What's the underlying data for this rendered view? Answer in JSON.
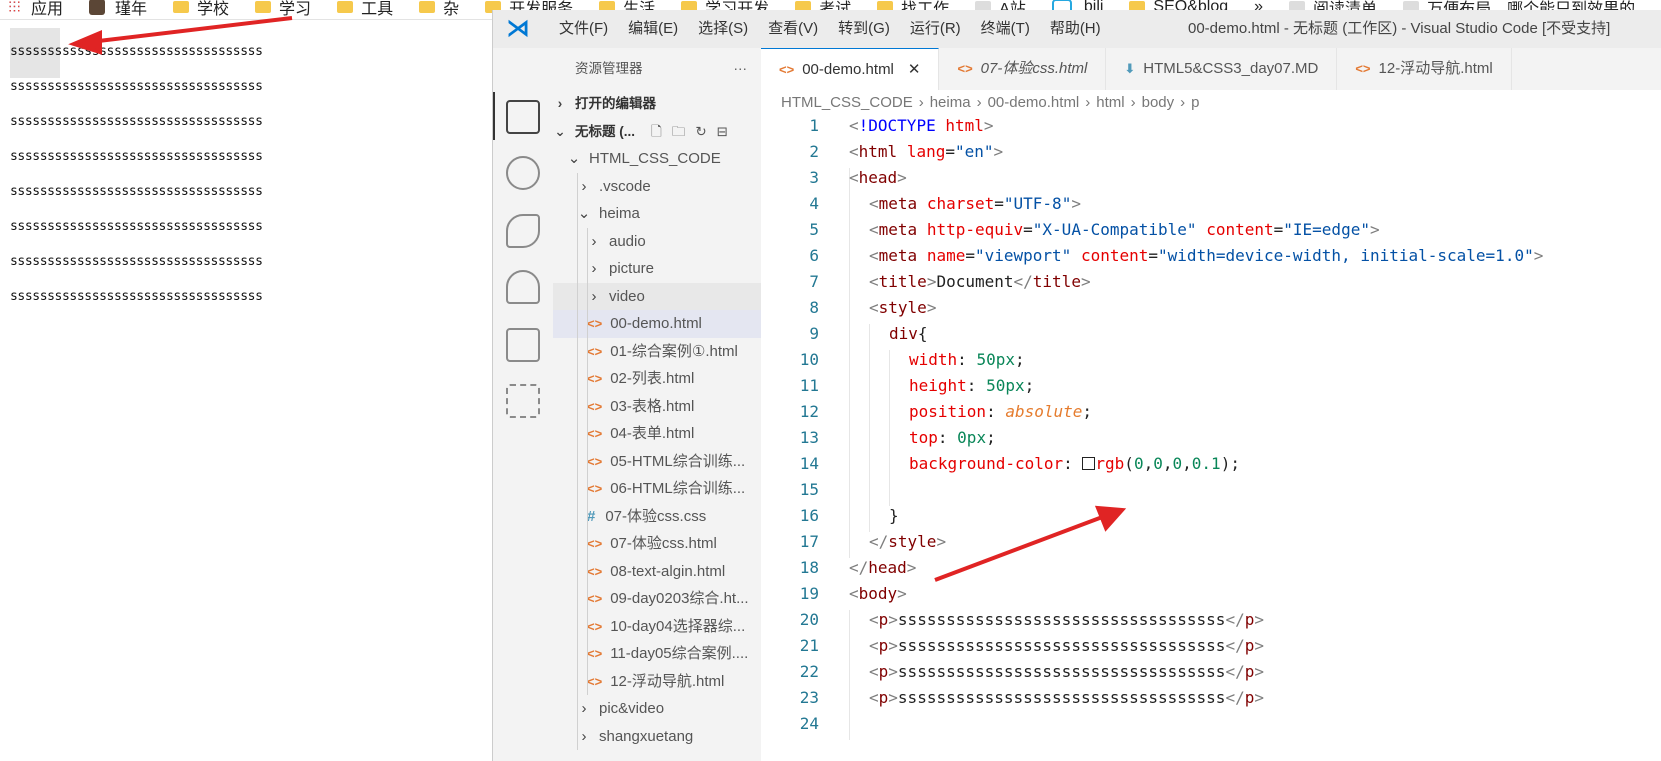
{
  "bookmarks": [
    {
      "label": "应用",
      "icon": "apps-grid-icon"
    },
    {
      "label": "瑾年",
      "icon": "avatar-icon"
    },
    {
      "label": "学校",
      "icon": "folder-icon"
    },
    {
      "label": "学习",
      "icon": "folder-icon"
    },
    {
      "label": "工具",
      "icon": "folder-icon"
    },
    {
      "label": "杂",
      "icon": "folder-icon"
    },
    {
      "label": "开发服务",
      "icon": "folder-icon"
    },
    {
      "label": "生活",
      "icon": "folder-icon"
    },
    {
      "label": "学习开发",
      "icon": "folder-icon"
    },
    {
      "label": "考试",
      "icon": "folder-icon"
    },
    {
      "label": "找工作",
      "icon": "folder-icon"
    },
    {
      "label": "A站",
      "icon": "acfun-icon"
    },
    {
      "label": "bili",
      "icon": "bilibili-icon"
    },
    {
      "label": "SEO&blog",
      "icon": "folder-icon"
    },
    {
      "label": "»",
      "icon": ""
    },
    {
      "label": "阅读清单",
      "icon": "reading-list-icon"
    },
    {
      "label": "万便布局，哪个能只到效果的",
      "icon": "page-icon"
    }
  ],
  "page": {
    "paragraphs": [
      "ssssssssssssssssssssssssssssssssss",
      "ssssssssssssssssssssssssssssssssss",
      "ssssssssssssssssssssssssssssssssss",
      "ssssssssssssssssssssssssssssssssss",
      "ssssssssssssssssssssssssssssssssss",
      "ssssssssssssssssssssssssssssssssss",
      "ssssssssssssssssssssssssssssssssss",
      "ssssssssssssssssssssssssssssssssss"
    ]
  },
  "vscode": {
    "menu": [
      "文件(F)",
      "编辑(E)",
      "选择(S)",
      "查看(V)",
      "转到(G)",
      "运行(R)",
      "终端(T)",
      "帮助(H)"
    ],
    "window_title": "00-demo.html - 无标题 (工作区) - Visual Studio Code [不受支持]",
    "explorer_title": "资源管理器",
    "explorer_more": "···",
    "open_editors": "打开的编辑器",
    "workspace": "无标题 (...",
    "tree": [
      {
        "label": "HTML_CSS_CODE",
        "kind": "folder-open",
        "depth": 1
      },
      {
        "label": ".vscode",
        "kind": "folder",
        "depth": 2
      },
      {
        "label": "heima",
        "kind": "folder-open",
        "depth": 2
      },
      {
        "label": "audio",
        "kind": "folder",
        "depth": 3
      },
      {
        "label": "picture",
        "kind": "folder",
        "depth": 3
      },
      {
        "label": "video",
        "kind": "folder",
        "depth": 3
      },
      {
        "label": "00-demo.html",
        "kind": "html",
        "depth": 3
      },
      {
        "label": "01-综合案例①.html",
        "kind": "html",
        "depth": 3
      },
      {
        "label": "02-列表.html",
        "kind": "html",
        "depth": 3
      },
      {
        "label": "03-表格.html",
        "kind": "html",
        "depth": 3
      },
      {
        "label": "04-表单.html",
        "kind": "html",
        "depth": 3
      },
      {
        "label": "05-HTML综合训练...",
        "kind": "html",
        "depth": 3
      },
      {
        "label": "06-HTML综合训练...",
        "kind": "html",
        "depth": 3
      },
      {
        "label": "07-体验css.css",
        "kind": "css",
        "depth": 3
      },
      {
        "label": "07-体验css.html",
        "kind": "html",
        "depth": 3
      },
      {
        "label": "08-text-algin.html",
        "kind": "html",
        "depth": 3
      },
      {
        "label": "09-day0203综合.ht...",
        "kind": "html",
        "depth": 3
      },
      {
        "label": "10-day04选择器综...",
        "kind": "html",
        "depth": 3
      },
      {
        "label": "11-day05综合案例....",
        "kind": "html",
        "depth": 3
      },
      {
        "label": "12-浮动导航.html",
        "kind": "html",
        "depth": 3
      },
      {
        "label": "pic&video",
        "kind": "folder",
        "depth": 2
      },
      {
        "label": "shangxuetang",
        "kind": "folder",
        "depth": 2
      }
    ],
    "tabs": [
      {
        "label": "00-demo.html",
        "icon": "html-icon",
        "close": "✕"
      },
      {
        "label": "07-体验css.html",
        "icon": "html-icon"
      },
      {
        "label": "HTML5&CSS3_day07.MD",
        "icon": "download-icon"
      },
      {
        "label": "12-浮动导航.html",
        "icon": "html-icon"
      }
    ],
    "breadcrumb": [
      "HTML_CSS_CODE",
      "›",
      "heima",
      "›",
      "00-demo.html",
      "›",
      "html",
      "›",
      "body",
      "›",
      "p"
    ],
    "line_numbers": [
      "1",
      "2",
      "3",
      "4",
      "5",
      "6",
      "7",
      "8",
      "9",
      "10",
      "11",
      "12",
      "13",
      "14",
      "15",
      "16",
      "17",
      "18",
      "19",
      "20",
      "21",
      "22",
      "23",
      "24"
    ]
  },
  "colors": {
    "accent": "#0078d4",
    "html_icon": "#e37933",
    "css_icon": "#519aba",
    "arrow": "#e02424"
  }
}
